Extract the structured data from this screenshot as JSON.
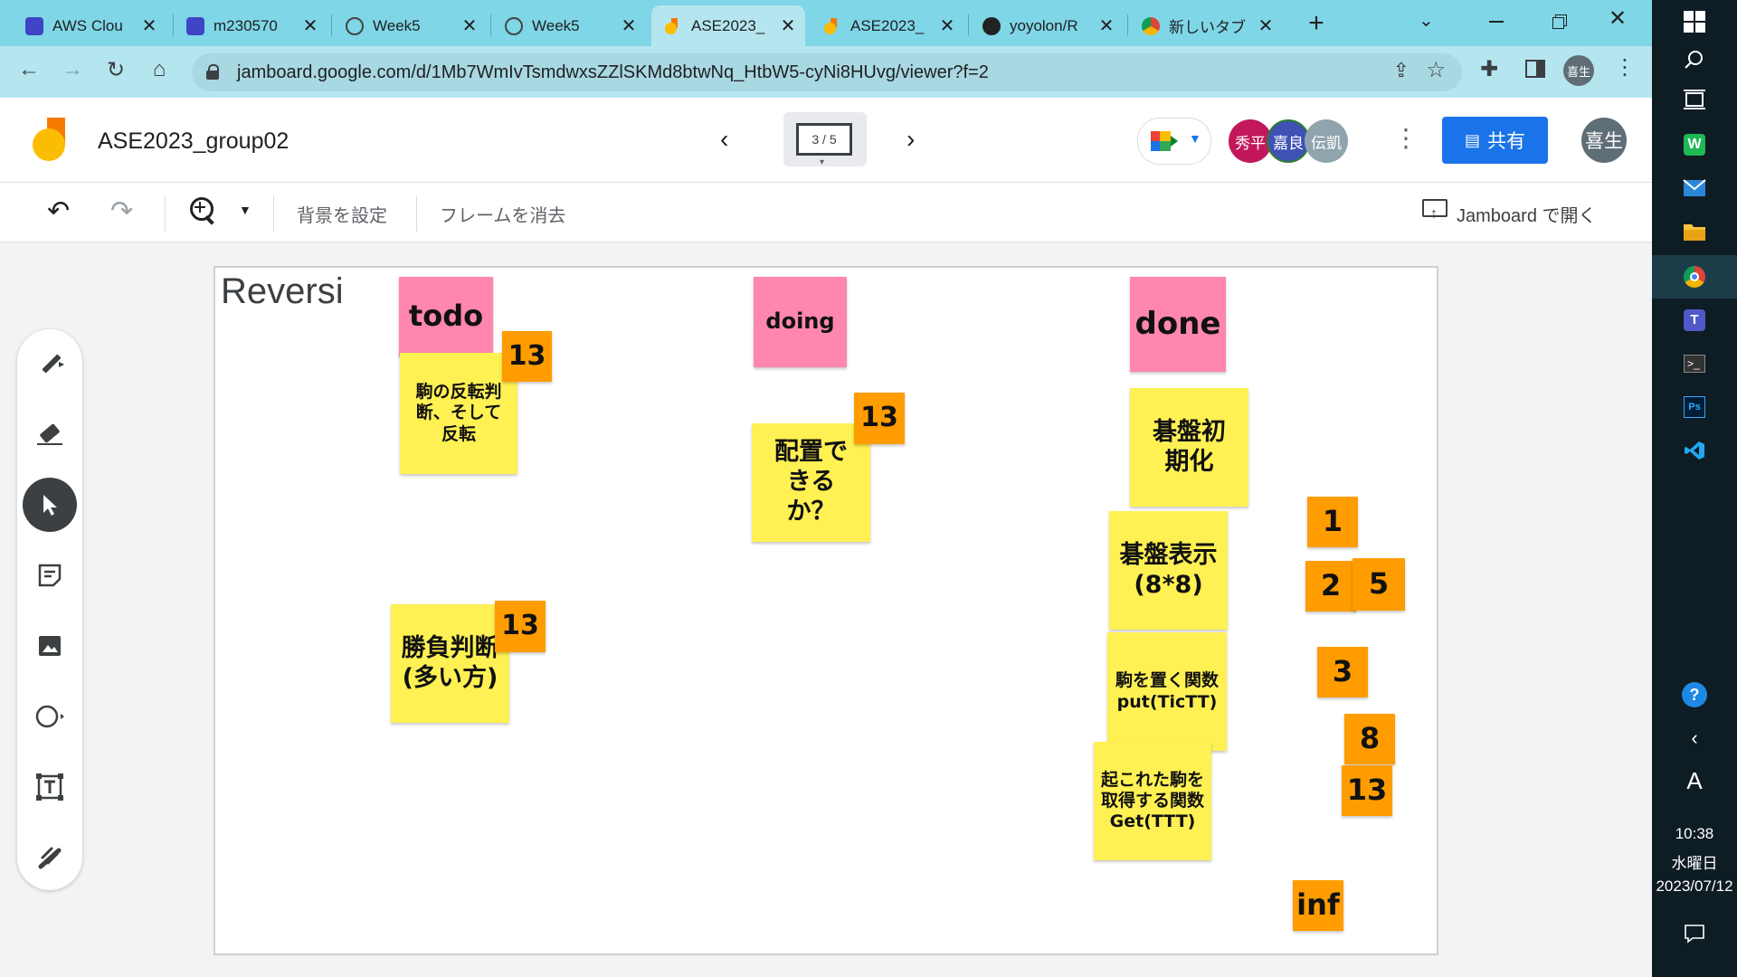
{
  "browser": {
    "tabs": [
      {
        "title": "AWS Clou",
        "icon": "aws-cloud-icon"
      },
      {
        "title": "m230570",
        "icon": "aws-cloud-icon"
      },
      {
        "title": "Week5",
        "icon": "globe-icon"
      },
      {
        "title": "Week5",
        "icon": "globe-icon"
      },
      {
        "title": "ASE2023_",
        "icon": "jamboard-icon",
        "active": true
      },
      {
        "title": "ASE2023_",
        "icon": "jamboard-icon"
      },
      {
        "title": "yoyolon/R",
        "icon": "github-icon"
      },
      {
        "title": "新しいタブ",
        "icon": "chrome-icon"
      }
    ],
    "url": "jamboard.google.com/d/1Mb7WmIvTsmdwxsZZlSKMd8btwNq_HtbW5-cyNi8HUvg/viewer?f=2",
    "profile_avatar": "喜生"
  },
  "app": {
    "title": "ASE2023_group02",
    "frame_indicator": "3 / 5",
    "collaborators": [
      {
        "name": "秀平",
        "color": "#c2185b"
      },
      {
        "name": "嘉良",
        "color": "#3f51b5"
      },
      {
        "name": "伝凱",
        "color": "#90a4ae"
      }
    ],
    "share_label": "共有",
    "user_avatar": "喜生"
  },
  "toolbar": {
    "set_background": "背景を設定",
    "clear_frame": "フレームを消去",
    "open_in_jamboard": "Jamboard で開く"
  },
  "board": {
    "title": "Reversi",
    "notes": [
      {
        "text": "todo",
        "color": "pink"
      },
      {
        "text": "13",
        "color": "orange"
      },
      {
        "text": "駒の反転判断、そして反転",
        "color": "yellow"
      },
      {
        "text": "doing",
        "color": "pink"
      },
      {
        "text": "13",
        "color": "orange"
      },
      {
        "text": "配置できるか？",
        "color": "yellow"
      },
      {
        "text": "done",
        "color": "pink"
      },
      {
        "text": "碁盤初期化",
        "color": "yellow"
      },
      {
        "text": "碁盤表示(8*8)",
        "color": "yellow"
      },
      {
        "text": "駒を置く関数put(TicTT)",
        "color": "yellow"
      },
      {
        "text": "起これた駒を取得する関数Get(TTT)",
        "color": "yellow"
      },
      {
        "text": "勝負判断(多い方)",
        "color": "yellow"
      },
      {
        "text": "13",
        "color": "orange"
      },
      {
        "text": "1",
        "color": "orange"
      },
      {
        "text": "2",
        "color": "orange"
      },
      {
        "text": "5",
        "color": "orange"
      },
      {
        "text": "3",
        "color": "orange"
      },
      {
        "text": "8",
        "color": "orange"
      },
      {
        "text": "13",
        "color": "orange"
      },
      {
        "text": "inf",
        "color": "orange"
      }
    ]
  },
  "taskbar": {
    "time": "10:38",
    "day": "水曜日",
    "date": "2023/07/12",
    "ime": "A"
  }
}
